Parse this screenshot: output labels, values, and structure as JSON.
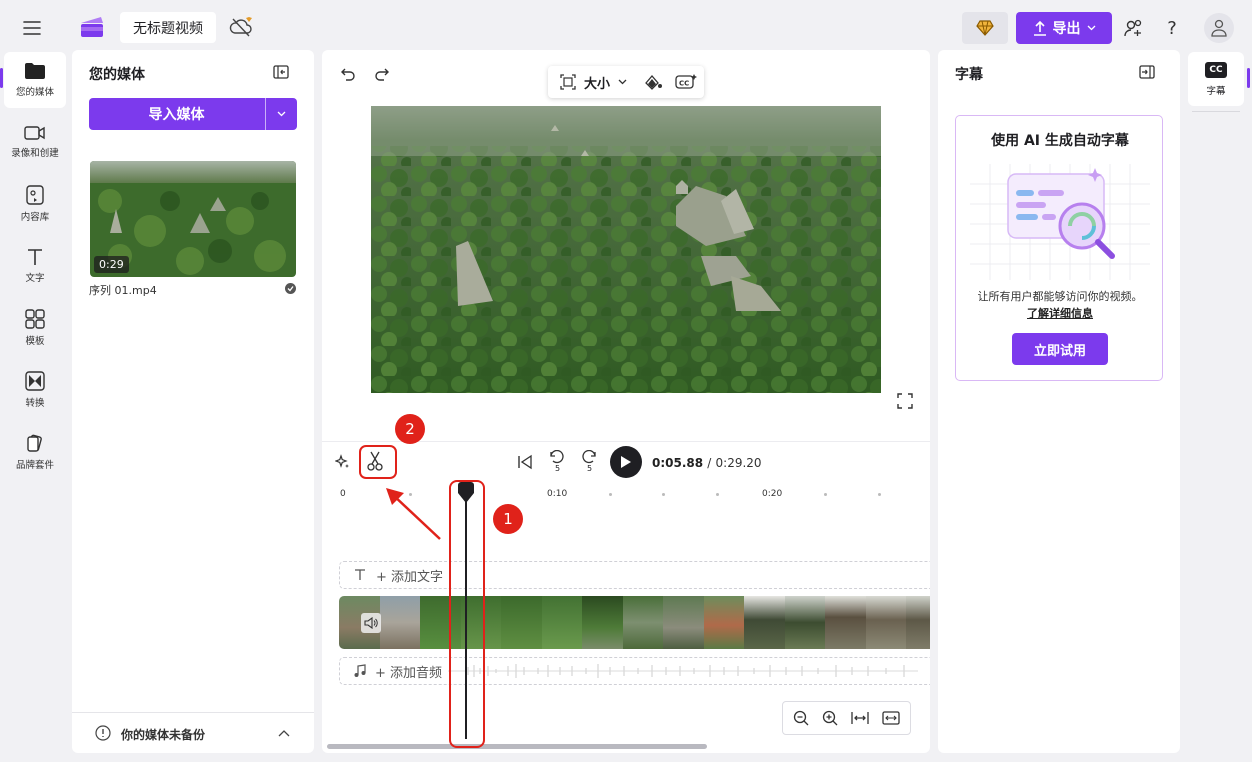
{
  "topbar": {
    "menu_icon": "hamburger-icon",
    "logo_icon": "clipchamp-logo",
    "project_title": "无标题视频",
    "cloud_status_icon": "cloud-off-premium-icon",
    "premium_icon": "diamond-icon",
    "export_label": "导出",
    "share_icon": "share-people-icon",
    "help_label": "?",
    "avatar_icon": "user-icon"
  },
  "left_rail": {
    "items": [
      {
        "label": "您的媒体",
        "icon": "folder-icon",
        "active": true
      },
      {
        "label": "录像和创建",
        "icon": "camera-icon"
      },
      {
        "label": "内容库",
        "icon": "library-icon"
      },
      {
        "label": "文字",
        "icon": "text-icon"
      },
      {
        "label": "模板",
        "icon": "templates-icon"
      },
      {
        "label": "转换",
        "icon": "transitions-icon"
      },
      {
        "label": "品牌套件",
        "icon": "brand-kit-icon"
      }
    ]
  },
  "media_panel": {
    "title": "您的媒体",
    "import_label": "导入媒体",
    "item": {
      "name": "序列 01.mp4",
      "duration": "0:29"
    },
    "backup_text": "你的媒体未备份"
  },
  "editor": {
    "size_label": "大小",
    "current_time": "0:05.88",
    "separator": "/",
    "total_time": "0:29.20",
    "rewind_label": "5",
    "forward_label": "5",
    "ruler": {
      "labels": [
        "0",
        "0:10",
        "0:20"
      ]
    },
    "text_track_label": "+ 添加文字",
    "audio_track_label": "+ 添加音频"
  },
  "captions_panel": {
    "title": "字幕",
    "promo_title": "使用 AI 生成自动字幕",
    "promo_desc": "让所有用户都能够访问你的视频。",
    "promo_link": "了解详细信息",
    "try_label": "立即试用"
  },
  "right_rail": {
    "badge": "CC",
    "label": "字幕"
  },
  "annotations": {
    "marker_1": "1",
    "marker_2": "2"
  },
  "colors": {
    "accent": "#7c3aed",
    "annotation": "#e0221a"
  }
}
